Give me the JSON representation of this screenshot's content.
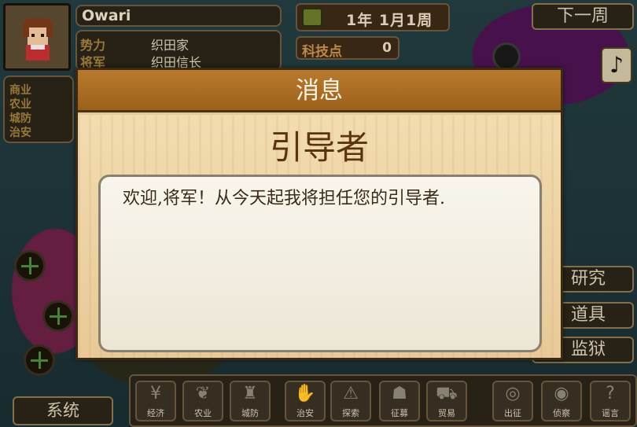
{
  "lord": {
    "province": "Owari",
    "faction_label": "势力",
    "faction_value": "织田家",
    "general_label": "将军",
    "general_value": "织田信长"
  },
  "stats": {
    "labels": [
      "商业",
      "农业",
      "城防",
      "治安"
    ]
  },
  "date": {
    "text": "1年 1月1周"
  },
  "tech": {
    "label": "科技点",
    "value": "0"
  },
  "buttons": {
    "next_week": "下一周",
    "research": "研究",
    "items": "道具",
    "prison": "监狱",
    "system": "系统"
  },
  "toolbar": {
    "items": [
      {
        "label": "经济",
        "icon": "yen-icon"
      },
      {
        "label": "农业",
        "icon": "wheat-icon"
      },
      {
        "label": "城防",
        "icon": "castle-wall-icon"
      },
      {
        "label": "治安",
        "icon": "hand-icon"
      },
      {
        "label": "探索",
        "icon": "warning-icon"
      },
      {
        "label": "征募",
        "icon": "soldiers-icon"
      },
      {
        "label": "贸易",
        "icon": "cart-icon"
      },
      {
        "label": "出征",
        "icon": "target-icon"
      },
      {
        "label": "侦察",
        "icon": "eye-icon"
      },
      {
        "label": "谣言",
        "icon": "speech-icon"
      }
    ]
  },
  "modal": {
    "header": "消息",
    "title": "引导者",
    "message": "欢迎,将军！从今天起我将担任您的引导者."
  }
}
